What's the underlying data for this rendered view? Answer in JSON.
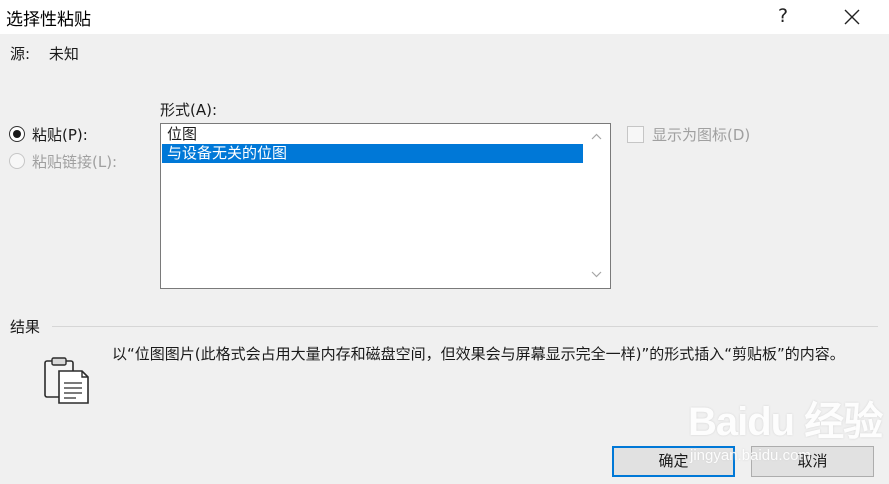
{
  "window": {
    "title": "选择性粘贴",
    "help_label": "?"
  },
  "source": {
    "label": "源:",
    "value": "未知"
  },
  "format": {
    "label": "形式(A):"
  },
  "options": {
    "paste": {
      "label": "粘贴(P):",
      "selected": true
    },
    "paste_link": {
      "label": "粘贴链接(L):",
      "enabled": false
    }
  },
  "formats_list": {
    "items": [
      {
        "label": "位图",
        "selected": false
      },
      {
        "label": "与设备无关的位图",
        "selected": true
      }
    ]
  },
  "display_as_icon": {
    "label": "显示为图标(D)",
    "checked": false,
    "enabled": false
  },
  "result": {
    "title": "结果",
    "description": "以“位图图片(此格式会占用大量内存和磁盘空间，但效果会与屏幕显示完全一样)”的形式插入“剪贴板”的内容。",
    "icon": "clipboard-icon"
  },
  "buttons": {
    "ok": "确定",
    "cancel": "取消"
  },
  "watermark": {
    "brand": "Baidu 经验",
    "url": "jingyan.baidu.com"
  },
  "colors": {
    "accent": "#0078d7",
    "background": "#f0f0f0",
    "disabled_text": "#a0a0a0"
  }
}
